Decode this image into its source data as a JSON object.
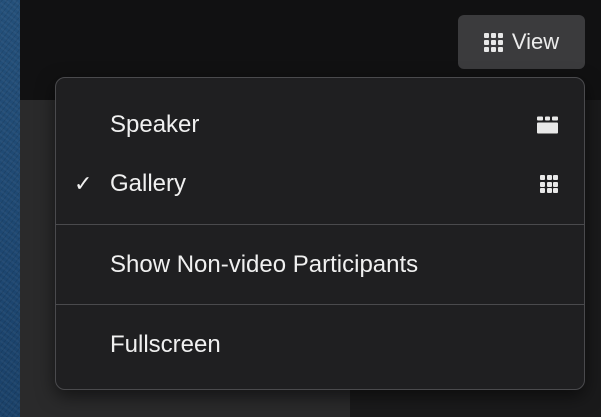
{
  "toolbar": {
    "view_label": "View",
    "view_icon": "grid-icon"
  },
  "view_menu": {
    "items": [
      {
        "label": "Speaker",
        "checked": false,
        "icon": "speaker-layout-icon"
      },
      {
        "label": "Gallery",
        "checked": true,
        "check_mark": "✓",
        "icon": "gallery-grid-icon"
      },
      {
        "label": "Show Non-video Participants",
        "checked": false
      },
      {
        "label": "Fullscreen",
        "checked": false
      }
    ]
  },
  "colors": {
    "menu_background": "#1f1f21",
    "menu_border": "#4a4a4d",
    "button_background": "#3b3b3d",
    "text": "#f0f0f0",
    "desktop_blue": "#1d4670"
  }
}
